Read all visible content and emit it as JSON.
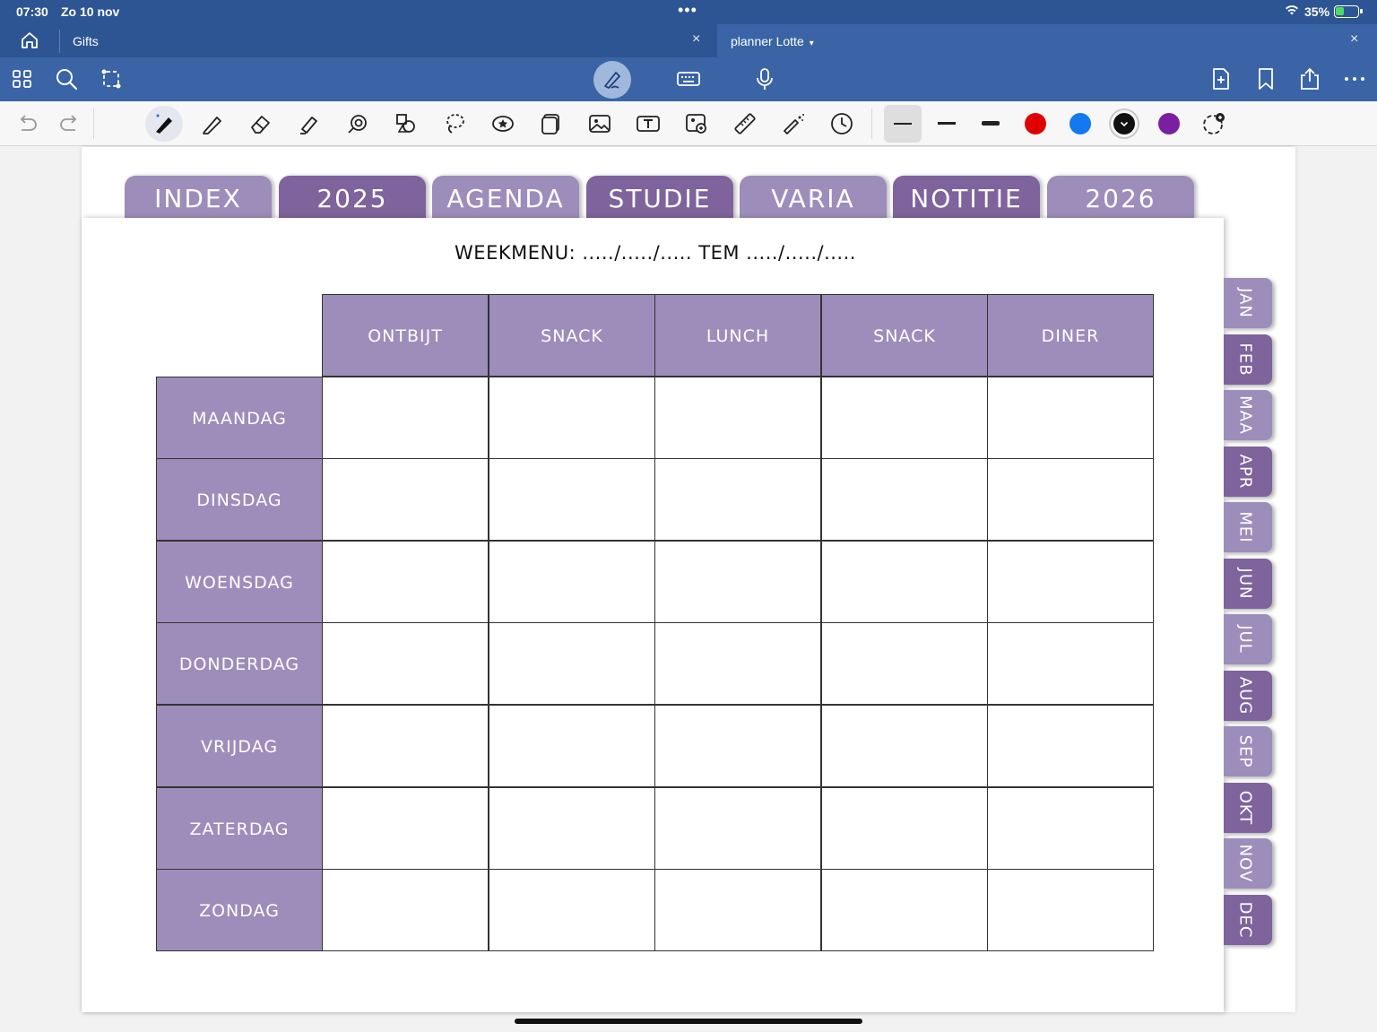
{
  "status_bar": {
    "time": "07:30",
    "date": "Zo 10 nov",
    "battery_percent": "35%"
  },
  "tabs": [
    {
      "label": "Gifts",
      "close": "×"
    },
    {
      "label": "planner Lotte",
      "close": "×"
    }
  ],
  "toolbar": {
    "icons": [
      "grid-icon",
      "search-icon",
      "lasso-shape-icon",
      "pen-mode-icon",
      "keyboard-icon",
      "microphone-icon",
      "add-page-icon",
      "bookmark-icon",
      "share-icon",
      "more-icon"
    ]
  },
  "tool_row": {
    "icons": [
      "undo-icon",
      "redo-icon",
      "pen-icon",
      "pencil-icon",
      "eraser-icon",
      "highlighter-icon",
      "shape-icon",
      "lasso-icon",
      "elements-icon",
      "sticker-icon",
      "image-icon",
      "text-icon",
      "camera-icon",
      "ruler-icon",
      "laser-icon",
      "timer-icon"
    ],
    "colors": [
      "#e00000",
      "#1478f0",
      "#111111",
      "#7a1fa2"
    ],
    "selected_color": "#111111"
  },
  "planner": {
    "section_tabs": [
      "INDEX",
      "2025",
      "AGENDA",
      "STUDIE",
      "VARIA",
      "NOTITIE",
      "2026"
    ],
    "title": "WEEKMENU: ...../...../..... TEM ...../...../.....",
    "columns": [
      "ONTBIJT",
      "SNACK",
      "LUNCH",
      "SNACK",
      "DINER"
    ],
    "days": [
      "MAANDAG",
      "DINSDAG",
      "WOENSDAG",
      "DONDERDAG",
      "VRIJDAG",
      "ZATERDAG",
      "ZONDAG"
    ],
    "months": [
      "JAN",
      "FEB",
      "MAA",
      "APR",
      "MEI",
      "JUN",
      "JUL",
      "AUG",
      "SEP",
      "OKT",
      "NOV",
      "DEC"
    ],
    "accent_light": "#9d8dbb",
    "accent_dark": "#7e639c"
  }
}
